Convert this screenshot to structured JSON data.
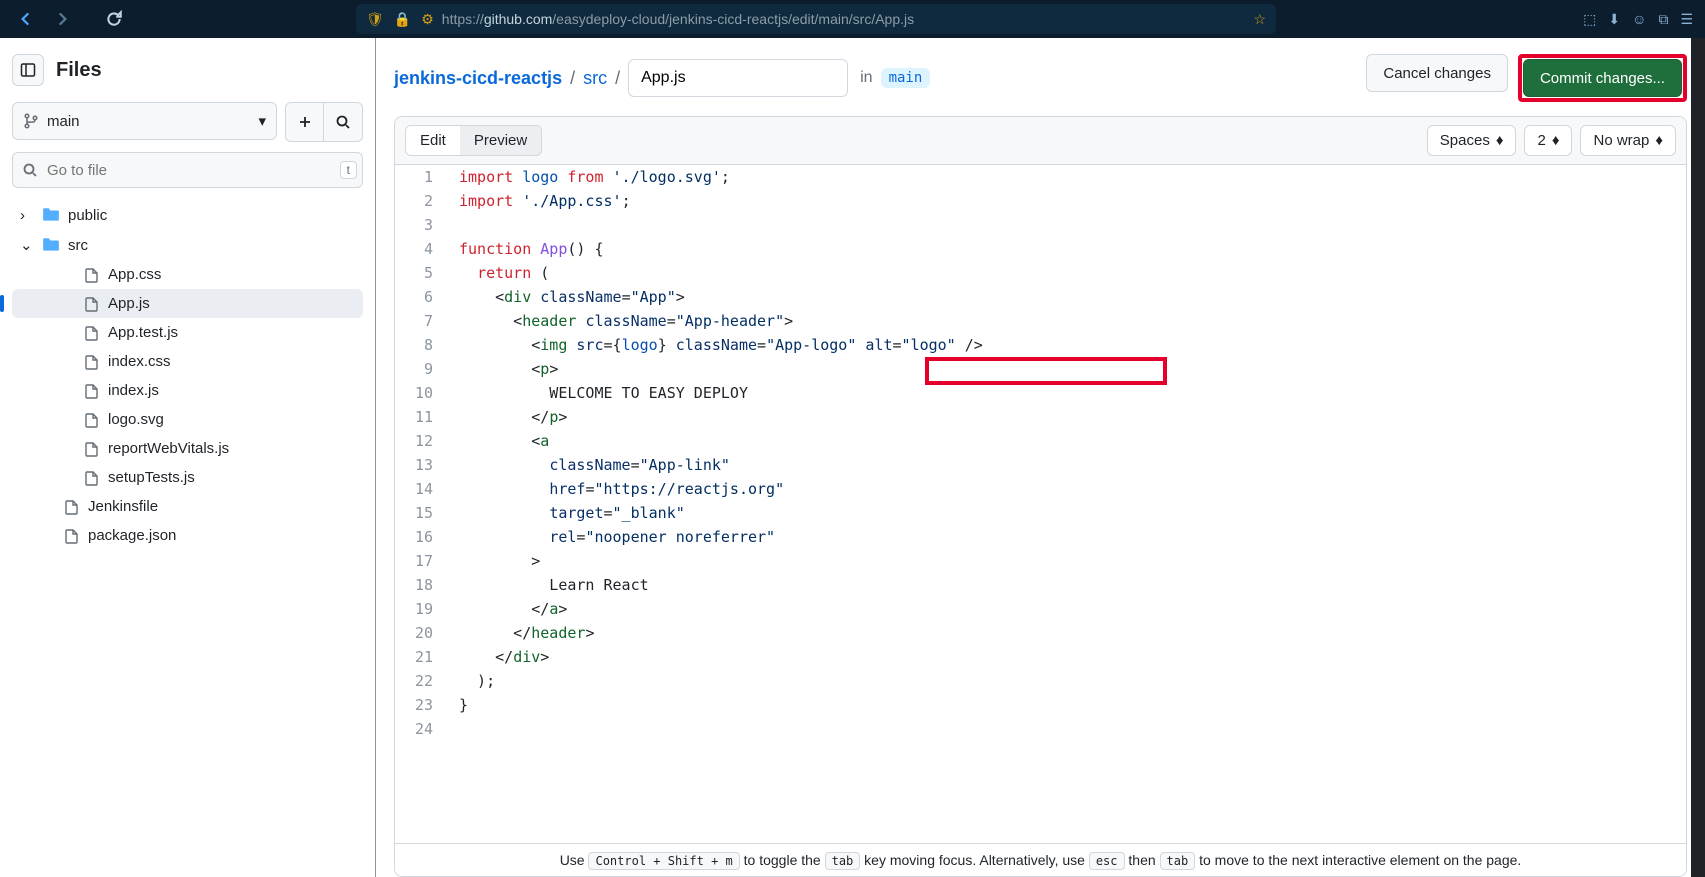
{
  "browser": {
    "url_prefix": "https://",
    "url_host": "github.com",
    "url_path": "/easydeploy-cloud/jenkins-cicd-reactjs/edit/main/src/App.js"
  },
  "sidebar": {
    "title": "Files",
    "branch": "main",
    "search_placeholder": "Go to file",
    "search_kbd": "t",
    "tree": [
      {
        "type": "folder",
        "name": "public",
        "expanded": false,
        "indent": 0
      },
      {
        "type": "folder",
        "name": "src",
        "expanded": true,
        "indent": 0
      },
      {
        "type": "file",
        "name": "App.css",
        "indent": 2
      },
      {
        "type": "file",
        "name": "App.js",
        "indent": 2,
        "active": true
      },
      {
        "type": "file",
        "name": "App.test.js",
        "indent": 2
      },
      {
        "type": "file",
        "name": "index.css",
        "indent": 2
      },
      {
        "type": "file",
        "name": "index.js",
        "indent": 2
      },
      {
        "type": "file",
        "name": "logo.svg",
        "indent": 2
      },
      {
        "type": "file",
        "name": "reportWebVitals.js",
        "indent": 2
      },
      {
        "type": "file",
        "name": "setupTests.js",
        "indent": 2
      },
      {
        "type": "file",
        "name": "Jenkinsfile",
        "indent": 1
      },
      {
        "type": "file",
        "name": "package.json",
        "indent": 1
      }
    ]
  },
  "breadcrumb": {
    "repo": "jenkins-cicd-reactjs",
    "path": "src",
    "filename": "App.js",
    "in_text": "in",
    "branch": "main",
    "cancel_label": "Cancel changes",
    "commit_label": "Commit changes..."
  },
  "editor": {
    "tab_edit": "Edit",
    "tab_preview": "Preview",
    "spaces_label": "Spaces",
    "indent_size": "2",
    "wrap_label": "No wrap",
    "lines": [
      {
        "n": 1,
        "html": "<span class='tok-kw'>import</span> <span class='tok-prop'>logo</span> <span class='tok-kw'>from</span> <span class='tok-str'>'./logo.svg'</span>;"
      },
      {
        "n": 2,
        "html": "<span class='tok-kw'>import</span> <span class='tok-str'>'./App.css'</span>;"
      },
      {
        "n": 3,
        "html": ""
      },
      {
        "n": 4,
        "html": "<span class='tok-kw'>function</span> <span class='tok-fn'>App</span>() {"
      },
      {
        "n": 5,
        "html": "  <span class='tok-kw'>return</span> ("
      },
      {
        "n": 6,
        "html": "    &lt;<span class='tok-tag'>div</span> <span class='tok-attr'>className</span>=<span class='tok-str'>\"App\"</span>&gt;"
      },
      {
        "n": 7,
        "html": "      &lt;<span class='tok-tag'>header</span> <span class='tok-attr'>className</span>=<span class='tok-str'>\"App-header\"</span>&gt;"
      },
      {
        "n": 8,
        "html": "        &lt;<span class='tok-tag'>img</span> <span class='tok-attr'>src</span>={<span class='tok-prop'>logo</span>} <span class='tok-attr'>className</span>=<span class='tok-str'>\"App-logo\"</span> <span class='tok-attr'>alt</span>=<span class='tok-str'>\"logo\"</span> /&gt;"
      },
      {
        "n": 9,
        "html": "        &lt;<span class='tok-tag'>p</span>&gt;"
      },
      {
        "n": 10,
        "html": "          WELCOME TO EASY DEPLOY"
      },
      {
        "n": 11,
        "html": "        &lt;/<span class='tok-tag'>p</span>&gt;"
      },
      {
        "n": 12,
        "html": "        &lt;<span class='tok-tag'>a</span>"
      },
      {
        "n": 13,
        "html": "          <span class='tok-attr'>className</span>=<span class='tok-str'>\"App-link\"</span>"
      },
      {
        "n": 14,
        "html": "          <span class='tok-attr'>href</span>=<span class='tok-str'>\"https://reactjs.org\"</span>"
      },
      {
        "n": 15,
        "html": "          <span class='tok-attr'>target</span>=<span class='tok-str'>\"_blank\"</span>"
      },
      {
        "n": 16,
        "html": "          <span class='tok-attr'>rel</span>=<span class='tok-str'>\"noopener noreferrer\"</span>"
      },
      {
        "n": 17,
        "html": "        &gt;"
      },
      {
        "n": 18,
        "html": "          Learn React"
      },
      {
        "n": 19,
        "html": "        &lt;/<span class='tok-tag'>a</span>&gt;"
      },
      {
        "n": 20,
        "html": "      &lt;/<span class='tok-tag'>header</span>&gt;"
      },
      {
        "n": 21,
        "html": "    &lt;/<span class='tok-tag'>div</span>&gt;"
      },
      {
        "n": 22,
        "html": "  );"
      },
      {
        "n": 23,
        "html": "}"
      },
      {
        "n": 24,
        "html": ""
      }
    ]
  },
  "footer": {
    "text1": "Use ",
    "kbd1": "Control + Shift + m",
    "text2": " to toggle the ",
    "kbd2": "tab",
    "text3": " key moving focus. Alternatively, use ",
    "kbd3": "esc",
    "text4": " then ",
    "kbd4": "tab",
    "text5": " to move to the next interactive element on the page."
  }
}
